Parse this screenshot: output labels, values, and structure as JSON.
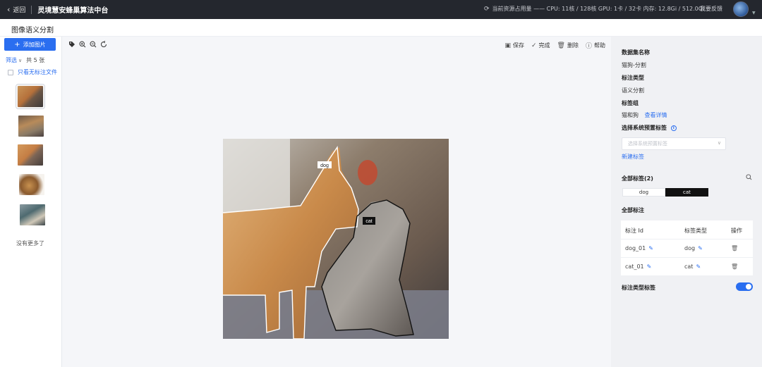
{
  "topbar": {
    "back_label": "返回",
    "app_title": "灵境慧安蜂巢算法中台",
    "resource_usage": "当前资源占用量 —— CPU: 11核 / 128核 GPU: 1卡 / 32卡 内存: 12.8Gi / 512.0Gi",
    "feedback_label": "我要反馈"
  },
  "page": {
    "title": "图像语义分割"
  },
  "left": {
    "add_image_label": "添加图片",
    "filter_label": "筛选",
    "count_label": "共 5 张",
    "unmarked_only_label": "只看无标注文件",
    "no_more_label": "没有更多了"
  },
  "toolbar": {
    "save_label": "保存",
    "done_label": "完成",
    "delete_label": "删除",
    "help_label": "帮助"
  },
  "annotations_on_image": {
    "dog_label": "dog",
    "cat_label": "cat"
  },
  "right": {
    "dataset_name_heading": "数据集名称",
    "dataset_name_value": "猫狗-分割",
    "annotation_type_heading": "标注类型",
    "annotation_type_value": "语义分割",
    "label_group_heading": "标签组",
    "label_group_value": "猫和狗",
    "view_details_label": "查看详情",
    "system_preset_heading": "选择系统预置标签",
    "system_preset_placeholder": "选择系统预置标签",
    "new_label_link": "新建标签",
    "all_labels_heading": "全部标签(2)",
    "tags": [
      "dog",
      "cat"
    ],
    "all_annotations_heading": "全部标注",
    "table": {
      "headers": [
        "标注 Id",
        "标签类型",
        "操作"
      ],
      "rows": [
        {
          "id": "dog_01",
          "type": "dog"
        },
        {
          "id": "cat_01",
          "type": "cat"
        }
      ]
    },
    "type_label_toggle_heading": "标注类型标签",
    "type_label_toggle_on": true
  },
  "colors": {
    "accent": "#2a6ef0",
    "topbar_bg": "#24272e"
  }
}
